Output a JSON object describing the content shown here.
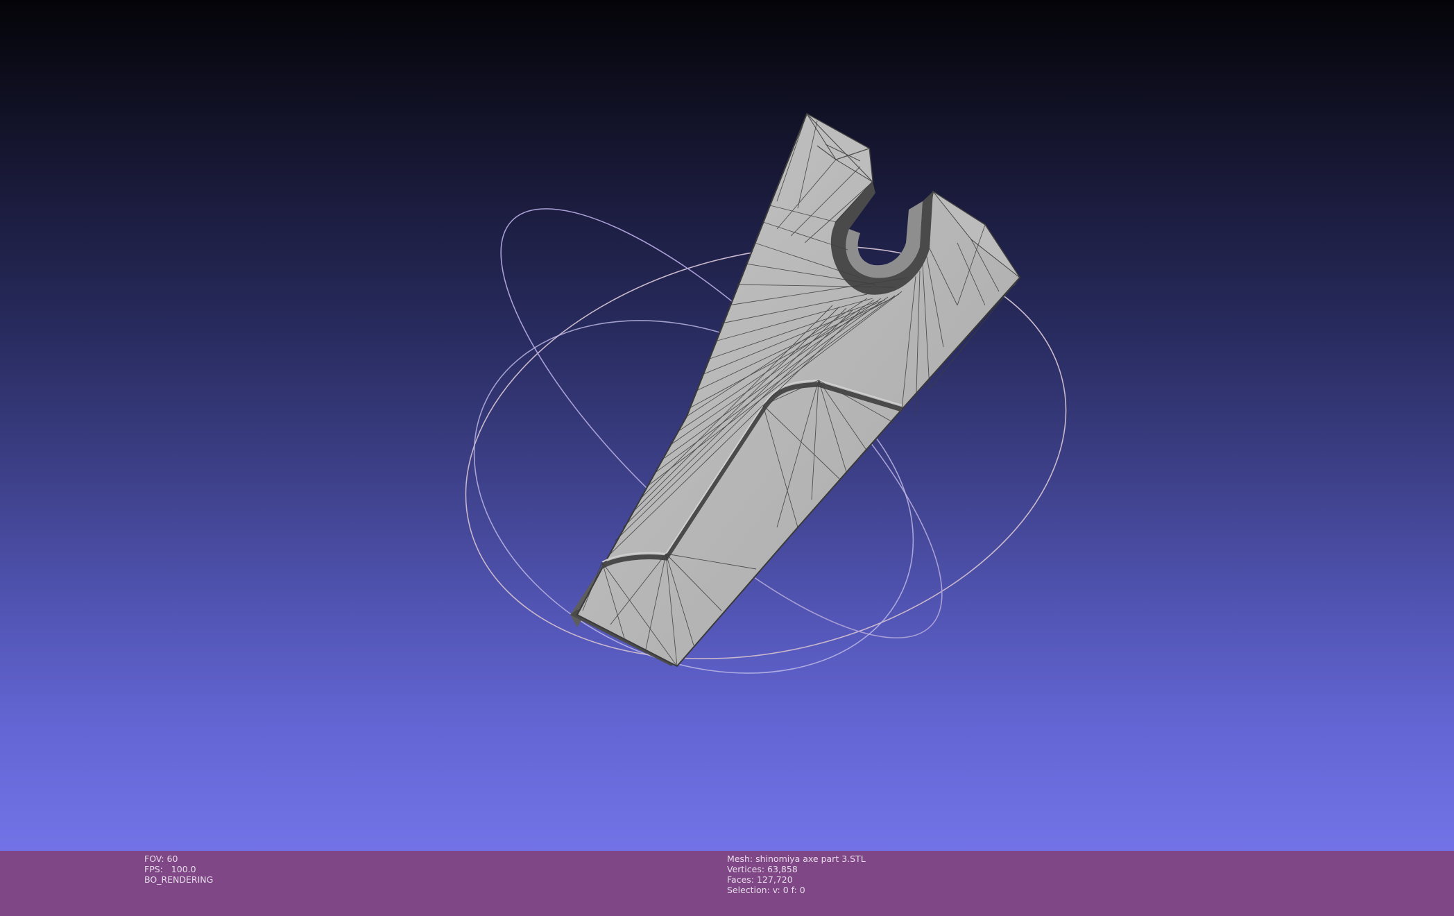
{
  "status_left": {
    "fov": "FOV: 60",
    "fps": "FPS:   100.0",
    "render_mode": "BO_RENDERING"
  },
  "status_right": {
    "mesh": "Mesh: shinomiya axe part 3.STL",
    "vertices": "Vertices: 63,858",
    "faces": "Faces: 127,720",
    "selection": "Selection: v: 0 f: 0"
  },
  "colors": {
    "status_bar": "#7f4786",
    "mesh_face": "#b4b4b4",
    "mesh_side": "#5c5c5c",
    "trackball": "#b8b0d0"
  },
  "icons": {
    "trackball": "trackball-gizmo"
  }
}
